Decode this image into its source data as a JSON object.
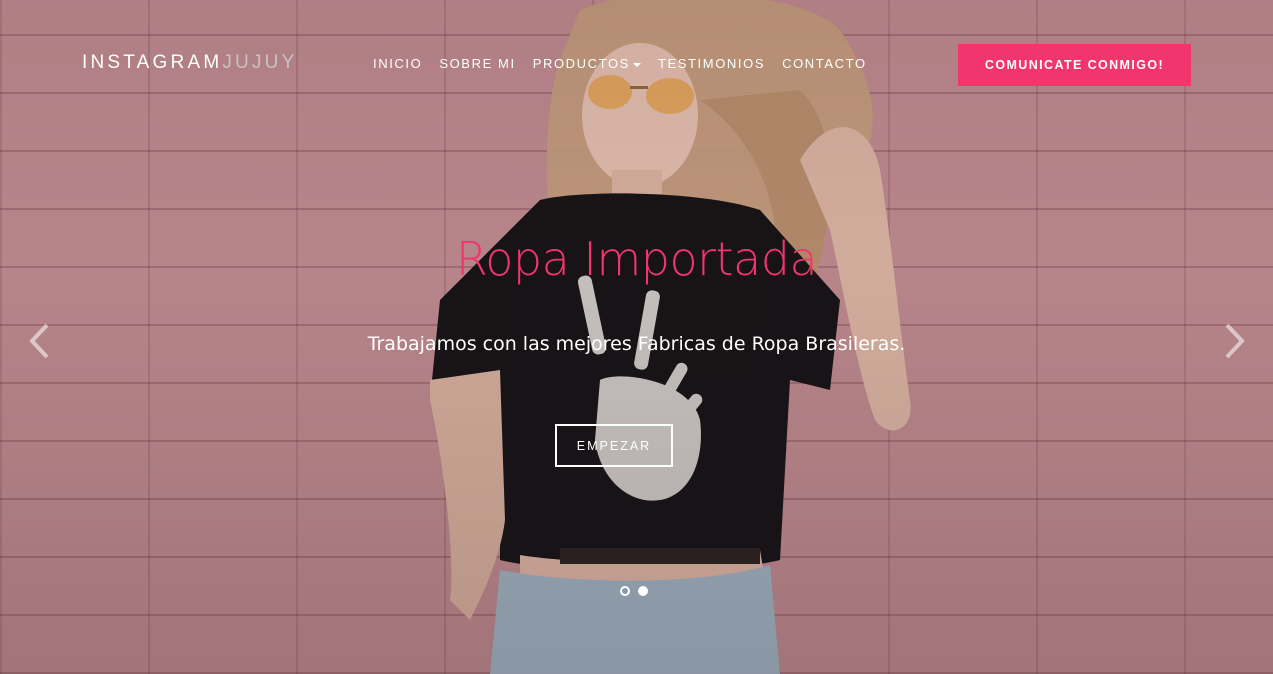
{
  "brand": {
    "main": "INSTAGRAM",
    "accent": "JUJUY"
  },
  "nav": {
    "items": [
      {
        "label": "INICIO"
      },
      {
        "label": "SOBRE MI"
      },
      {
        "label": "PRODUCTOS"
      },
      {
        "label": "TESTIMONIOS"
      },
      {
        "label": "CONTACTO"
      }
    ],
    "cta_label": "COMUNICATE CONMIGO!"
  },
  "hero": {
    "title": "Ropa Importada",
    "subtitle": "Trabajamos con las mejores Fabricas de Ropa Brasileras.",
    "button_label": "EMPEZAR"
  },
  "carousel": {
    "prev_icon": "chevron-left-icon",
    "next_icon": "chevron-right-icon",
    "slide_count": 2,
    "active_slide": 2
  },
  "colors": {
    "accent": "#f2356d",
    "text": "#ffffff",
    "wall": "#bd8a8f"
  }
}
